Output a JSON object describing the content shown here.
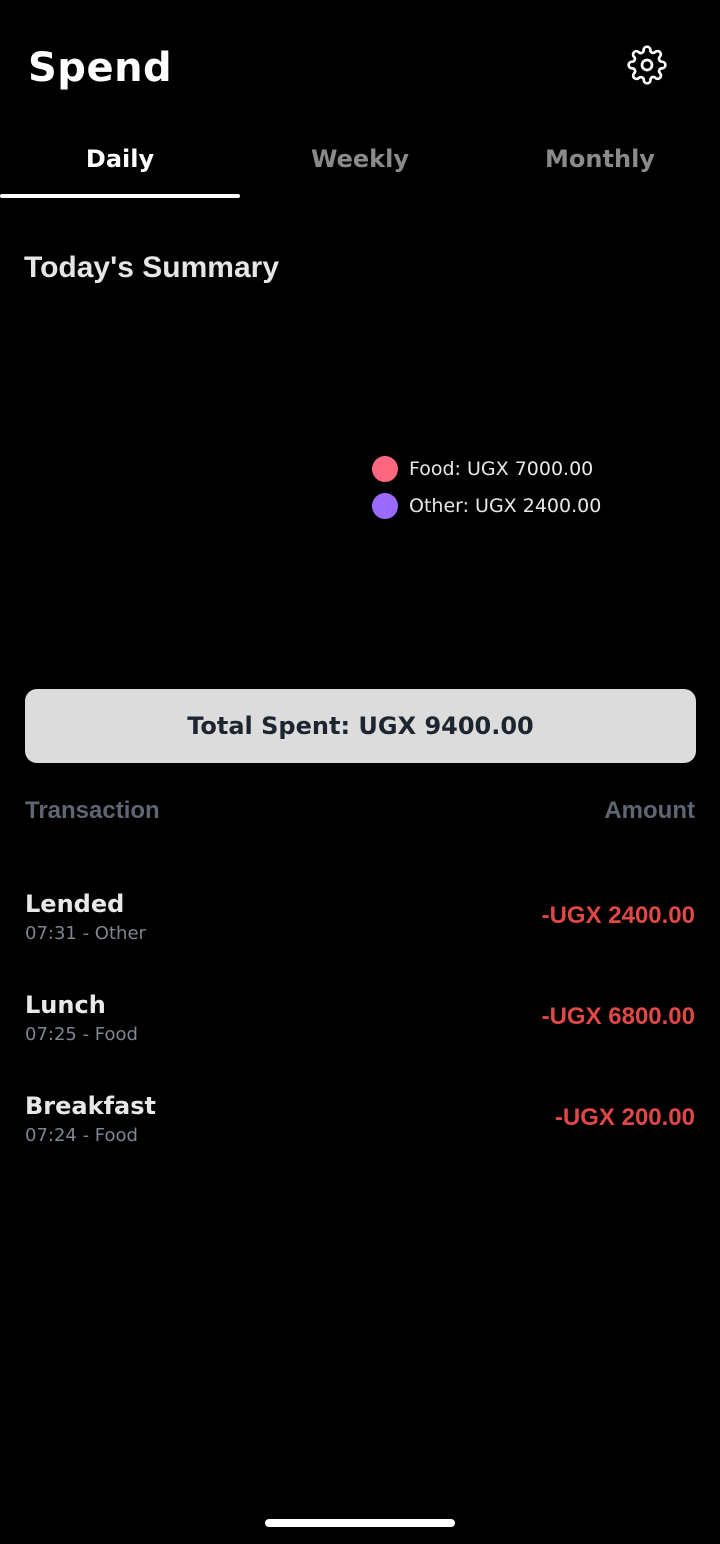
{
  "header": {
    "title": "Spend",
    "settings_icon": "gear-icon"
  },
  "tabs": [
    {
      "label": "Daily",
      "active": true
    },
    {
      "label": "Weekly",
      "active": false
    },
    {
      "label": "Monthly",
      "active": false
    }
  ],
  "summary": {
    "title": "Today's Summary",
    "legend": [
      {
        "label": "Food: UGX 7000.00",
        "color": "#ff6680"
      },
      {
        "label": "Other: UGX 2400.00",
        "color": "#9b6bff"
      }
    ],
    "total": "Total Spent: UGX 9400.00"
  },
  "table": {
    "transaction_header": "Transaction",
    "amount_header": "Amount",
    "rows": [
      {
        "name": "Lended",
        "sub": "07:31 - Other",
        "amount": "-UGX 2400.00"
      },
      {
        "name": "Lunch",
        "sub": "07:25 - Food",
        "amount": "-UGX 6800.00"
      },
      {
        "name": "Breakfast",
        "sub": "07:24 - Food",
        "amount": "-UGX 200.00"
      }
    ]
  },
  "colors": {
    "background": "#000000",
    "negative_amount": "#e04848",
    "total_box": "#dcdcdc"
  }
}
